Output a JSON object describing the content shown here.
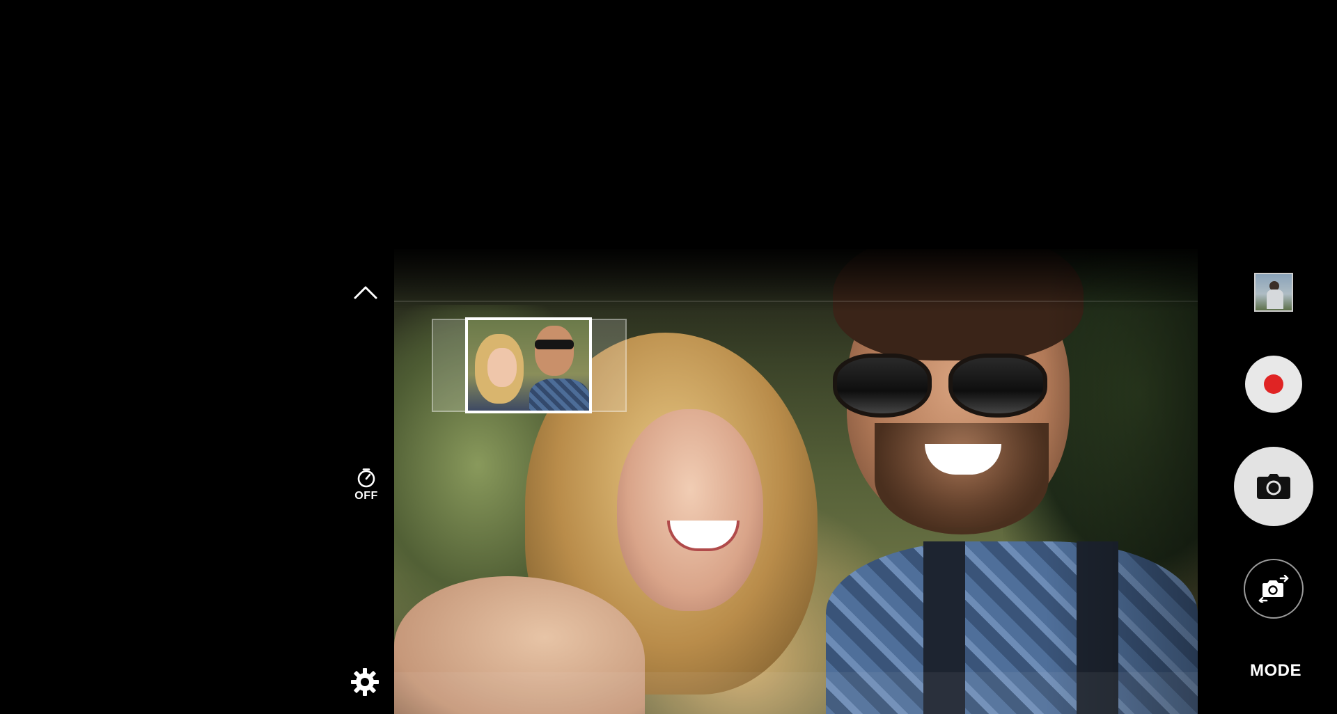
{
  "left_controls": {
    "collapse_icon": "chevron-up-icon",
    "timer_icon": "timer-icon",
    "timer_label": "OFF",
    "settings_icon": "gear-icon"
  },
  "right_controls": {
    "gallery_icon": "gallery-thumbnail",
    "record_icon": "record-icon",
    "record_color": "#e02424",
    "shutter_icon": "camera-icon",
    "switch_camera_icon": "switch-camera-icon",
    "mode_label": "MODE"
  },
  "colors": {
    "background": "#000000",
    "button_fill": "#e8e8e8",
    "record_red": "#e02424"
  }
}
